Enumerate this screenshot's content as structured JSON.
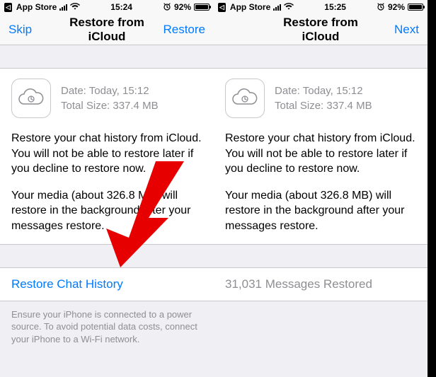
{
  "left": {
    "status": {
      "app": "App Store",
      "time": "15:24",
      "battery_pct": "92%"
    },
    "nav": {
      "left": "Skip",
      "title": "Restore from iCloud",
      "right": "Restore"
    },
    "info": {
      "date": "Date: Today, 15:12",
      "size": "Total Size: 337.4 MB",
      "p1": "Restore your chat history from iCloud. You will not be able to restore later if you decline to restore now.",
      "p2": "Your media (about 326.8 MB) will restore in the background after your messages restore."
    },
    "action": "Restore Chat History",
    "footer": "Ensure your iPhone is connected to a power source. To avoid potential data costs, connect your iPhone to a Wi-Fi network."
  },
  "right": {
    "status": {
      "app": "App Store",
      "time": "15:25",
      "battery_pct": "92%"
    },
    "nav": {
      "left": "",
      "title": "Restore from iCloud",
      "right": "Next"
    },
    "info": {
      "date": "Date: Today, 15:12",
      "size": "Total Size: 337.4 MB",
      "p1": "Restore your chat history from iCloud. You will not be able to restore later if you decline to restore now.",
      "p2": "Your media (about 326.8 MB) will restore in the background after your messages restore."
    },
    "action": "31,031 Messages Restored"
  }
}
